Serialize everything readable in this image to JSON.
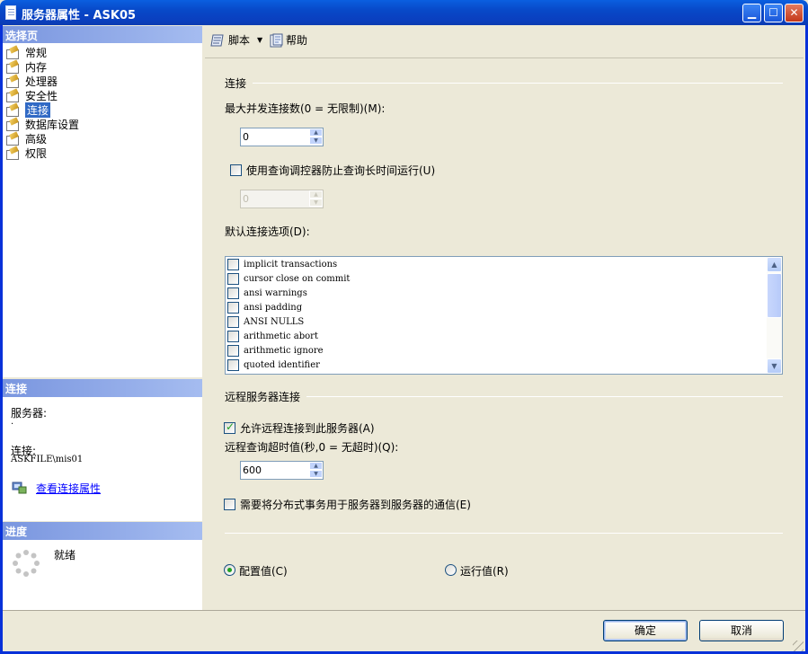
{
  "window": {
    "title": "服务器属性 - ASK05"
  },
  "sidebar": {
    "header": "选择页",
    "items": [
      {
        "label": "常规"
      },
      {
        "label": "内存"
      },
      {
        "label": "处理器"
      },
      {
        "label": "安全性"
      },
      {
        "label": "连接"
      },
      {
        "label": "数据库设置"
      },
      {
        "label": "高级"
      },
      {
        "label": "权限"
      }
    ],
    "selected": "连接"
  },
  "connection_info": {
    "header": "连接",
    "server_label": "服务器:",
    "server_value": ".",
    "connection_label": "连接:",
    "connection_value": "ASKFILE\\mis01",
    "view_link": "查看连接属性"
  },
  "progress": {
    "header": "进度",
    "status": "就绪"
  },
  "toolbar": {
    "script_label": "脚本",
    "help_label": "帮助"
  },
  "main": {
    "connections_group": "连接",
    "max_conn_label": "最大并发连接数(0 = 无限制)(M):",
    "max_conn_value": "0",
    "query_governor_label": "使用查询调控器防止查询长时间运行(U)",
    "query_governor_value": "0",
    "default_options_label": "默认连接选项(D):",
    "default_options": [
      "implicit transactions",
      "cursor close on commit",
      "ansi warnings",
      "ansi padding",
      "ANSI NULLS",
      "arithmetic abort",
      "arithmetic ignore",
      "quoted identifier"
    ],
    "remote_group": "远程服务器连接",
    "allow_remote_label": "允许远程连接到此服务器(A)",
    "allow_remote_checked": true,
    "remote_timeout_label": "远程查询超时值(秒,0 = 无超时)(Q):",
    "remote_timeout_value": "600",
    "distributed_tx_label": "需要将分布式事务用于服务器到服务器的通信(E)",
    "config_value_label": "配置值(C)",
    "running_value_label": "运行值(R)",
    "selected_radio": "配置值(C)"
  },
  "footer": {
    "ok_label": "确定",
    "cancel_label": "取消"
  },
  "colors": {
    "titlebar": "#0a4fd0",
    "section_header": "#7a96df",
    "selection": "#316ac5",
    "link": "#0000ff",
    "check": "#21a121"
  }
}
